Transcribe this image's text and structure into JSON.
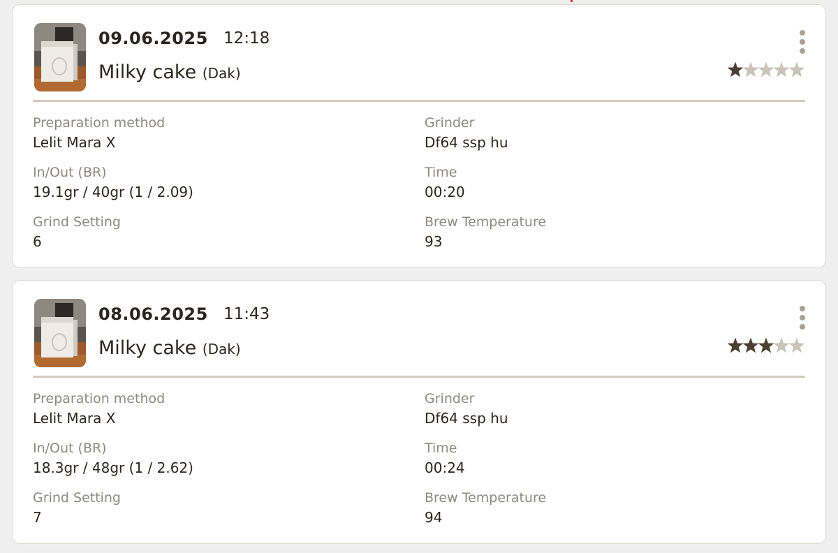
{
  "brews": [
    {
      "date": "09.06.2025",
      "time": "12:18",
      "bean_name": "Milky cake",
      "roaster": "(Dak)",
      "rating": 1,
      "rating_max": 5,
      "fields": {
        "preparation_label": "Preparation method",
        "preparation_value": "Lelit Mara X",
        "grinder_label": "Grinder",
        "grinder_value": "Df64 ssp hu",
        "inout_label": "In/Out (BR)",
        "inout_value": "19.1gr / 40gr (1 / 2.09)",
        "time_label": "Time",
        "time_value": "00:20",
        "grind_label": "Grind Setting",
        "grind_value": "6",
        "temp_label": "Brew Temperature",
        "temp_value": "93"
      }
    },
    {
      "date": "08.06.2025",
      "time": "11:43",
      "bean_name": "Milky cake",
      "roaster": "(Dak)",
      "rating": 3,
      "rating_max": 5,
      "fields": {
        "preparation_label": "Preparation method",
        "preparation_value": "Lelit Mara X",
        "grinder_label": "Grinder",
        "grinder_value": "Df64 ssp hu",
        "inout_label": "In/Out (BR)",
        "inout_value": "18.3gr / 48gr (1 / 2.62)",
        "time_label": "Time",
        "time_value": "00:24",
        "grind_label": "Grind Setting",
        "grind_value": "7",
        "temp_label": "Brew Temperature",
        "temp_value": "94"
      }
    }
  ],
  "colors": {
    "star_filled": "#4a3f30",
    "star_empty": "#c9c3b8",
    "divider": "#d3cabc",
    "menu_dots": "#a7a295"
  },
  "icons": {
    "menu": "more-vertical-icon",
    "star": "star-icon"
  }
}
